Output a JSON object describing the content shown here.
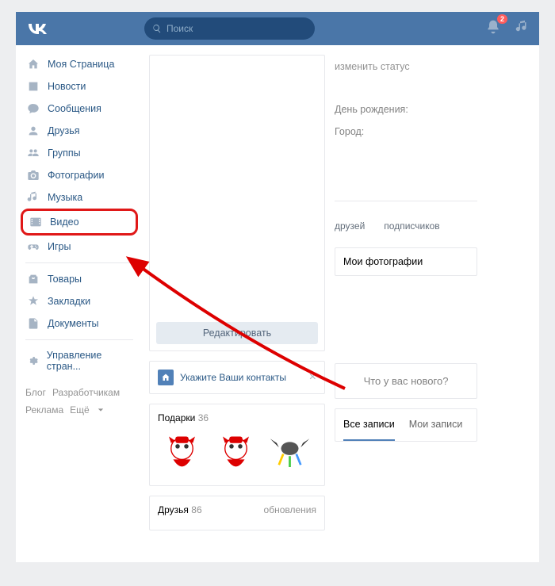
{
  "header": {
    "search_placeholder": "Поиск",
    "notification_count": "2"
  },
  "sidebar": {
    "items": [
      {
        "label": "Моя Страница"
      },
      {
        "label": "Новости"
      },
      {
        "label": "Сообщения"
      },
      {
        "label": "Друзья"
      },
      {
        "label": "Группы"
      },
      {
        "label": "Фотографии"
      },
      {
        "label": "Музыка"
      },
      {
        "label": "Видео"
      },
      {
        "label": "Игры"
      },
      {
        "label": "Товары"
      },
      {
        "label": "Закладки"
      },
      {
        "label": "Документы"
      },
      {
        "label": "Управление стран..."
      }
    ],
    "footer": {
      "blog": "Блог",
      "devs": "Разработчикам",
      "ads": "Реклама",
      "more": "Ещё"
    }
  },
  "main": {
    "edit_btn": "Редактировать",
    "contacts_prompt": "Укажите Ваши контакты",
    "gifts_title": "Подарки",
    "gifts_count": "36",
    "friends_title": "Друзья",
    "friends_count": "86",
    "updates": "обновления"
  },
  "right": {
    "status": "изменить статус",
    "birthday": "День рождения:",
    "city": "Город:",
    "friends": "друзей",
    "subs": "подписчиков",
    "photos": "Мои фотографии",
    "whatsnew": "Что у вас нового?",
    "tab_all": "Все записи",
    "tab_my": "Мои записи"
  }
}
